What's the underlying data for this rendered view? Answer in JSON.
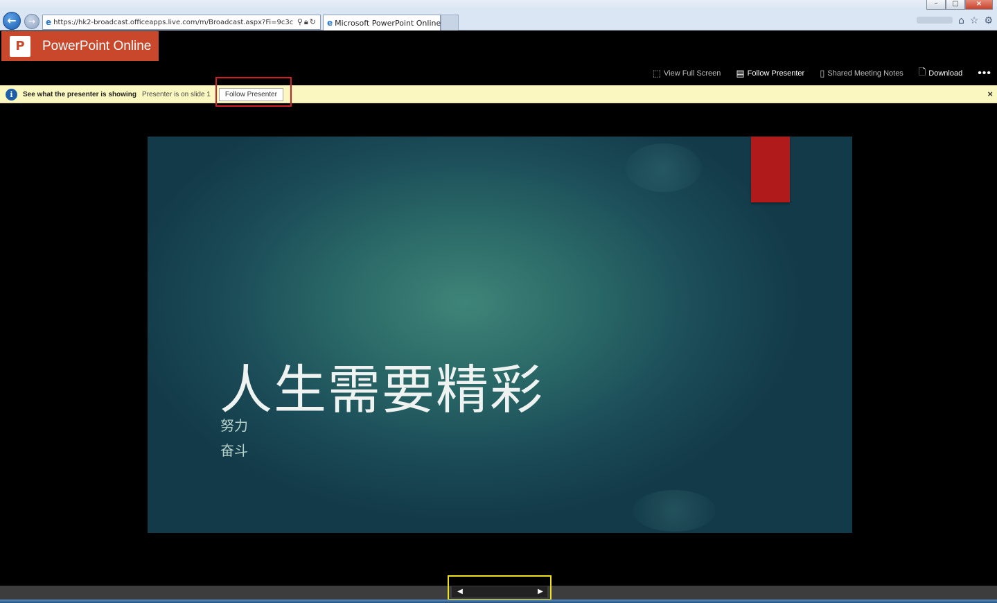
{
  "browser": {
    "url": "https://hk2-broadcast.officeapps.live.com/m/Broadcast.aspx?Fi=9c3c",
    "tab_title": "Microsoft PowerPoint Online",
    "tab_close": "×",
    "win_min": "–",
    "win_max": "□",
    "win_close": "×"
  },
  "app": {
    "brand_name": "PowerPoint Online",
    "toolbar": {
      "full_screen": "View Full Screen",
      "follow_presenter": "Follow Presenter",
      "meeting_notes": "Shared Meeting Notes",
      "download": "Download",
      "more": "•••"
    }
  },
  "notice": {
    "headline": "See what the presenter is showing",
    "status": "Presenter is on slide 1",
    "button": "Follow Presenter",
    "close": "×"
  },
  "slide": {
    "title": "人生需要精彩",
    "subtitle_1": "努力",
    "subtitle_2": "奋斗"
  },
  "nav": {
    "prev": "◀",
    "next": "▶"
  },
  "colors": {
    "brand": "#c9482b",
    "notice_bg": "#fbf7c0",
    "highlight_red": "#d21f26",
    "highlight_yellow": "#f2e21b",
    "slide_accent": "#b01a1a"
  },
  "icons": [
    "back-arrow-icon",
    "forward-arrow-icon",
    "ie-icon",
    "search-icon",
    "lock-icon",
    "refresh-icon",
    "home-icon",
    "star-icon",
    "gear-icon",
    "full-screen-icon",
    "follow-presenter-icon",
    "meeting-notes-icon",
    "download-icon",
    "info-icon",
    "close-icon"
  ]
}
